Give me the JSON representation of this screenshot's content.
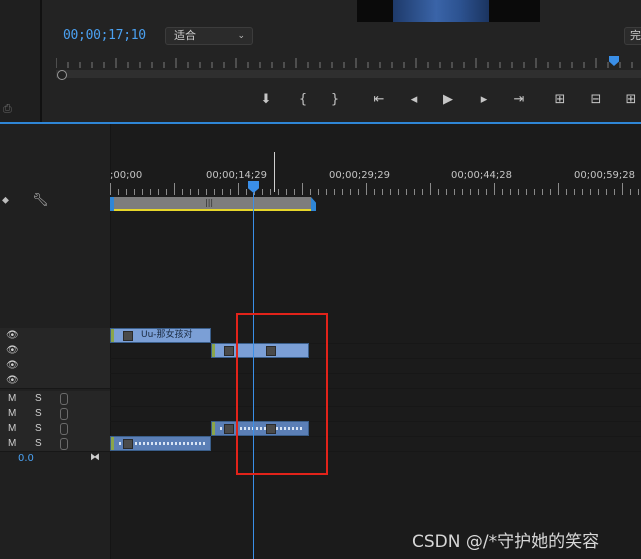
{
  "monitor": {
    "timecode": "00;00;17;10",
    "fit_select": "适合",
    "right_button": "完",
    "transport": [
      {
        "icon": "add-marker-icon",
        "glyph": "⬇"
      },
      {
        "icon": "mark-in-icon",
        "glyph": "{"
      },
      {
        "icon": "mark-out-icon",
        "glyph": "}"
      },
      {
        "icon": "go-to-in-icon",
        "glyph": "⇤"
      },
      {
        "icon": "step-back-icon",
        "glyph": "◂"
      },
      {
        "icon": "play-icon",
        "glyph": "▶"
      },
      {
        "icon": "step-forward-icon",
        "glyph": "▸"
      },
      {
        "icon": "go-to-out-icon",
        "glyph": "⇥"
      },
      {
        "icon": "lift-icon",
        "glyph": "⊞"
      },
      {
        "icon": "extract-icon",
        "glyph": "⊟"
      },
      {
        "icon": "export-frame-icon",
        "glyph": "⊞"
      }
    ]
  },
  "timeline": {
    "ruler_labels": [
      ";00;00",
      "00;00;14;29",
      "00;00;29;29",
      "00;00;44;28",
      "00;00;59;28"
    ],
    "clips": {
      "v3_clip_name": "Uu-那女孩对"
    },
    "audio_tracks": [
      {
        "m": "M",
        "s": "S"
      },
      {
        "m": "M",
        "s": "S"
      },
      {
        "m": "M",
        "s": "S"
      },
      {
        "m": "M",
        "s": "S"
      }
    ],
    "master_volume": "0.0"
  },
  "watermark": "CSDN @/*守护她的笑容",
  "colors": {
    "accent": "#2f86d6",
    "playhead": "#3a8fe8",
    "video_clip": "#7b9fd6",
    "audio_clip": "#5b7fb6",
    "work_area_bar": "#e6d62a",
    "annotation_box": "#e2231a"
  }
}
